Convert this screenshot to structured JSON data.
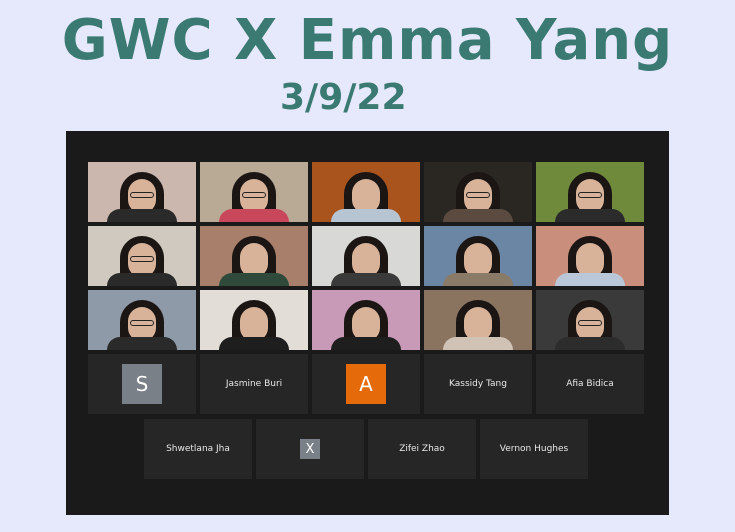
{
  "header": {
    "title": "GWC X Emma Yang",
    "date": "3/9/22"
  },
  "video_tiles": [
    {
      "bg": "#cbb7ad",
      "shirt": "#2a2a2a",
      "glasses": true
    },
    {
      "bg": "#b9aa96",
      "shirt": "#c9475a",
      "glasses": true
    },
    {
      "bg": "#a9541d",
      "shirt": "#b7c4d2",
      "glasses": false,
      "active": true
    },
    {
      "bg": "#2a2622",
      "shirt": "#5a4a40",
      "glasses": true
    },
    {
      "bg": "#6f8a3a",
      "shirt": "#2b2b2b",
      "glasses": true
    },
    {
      "bg": "#cfc9bf",
      "shirt": "#2a2a2a",
      "glasses": true
    },
    {
      "bg": "#a87f6a",
      "shirt": "#2f4a3a",
      "glasses": false
    },
    {
      "bg": "#d8d8d6",
      "shirt": "#3a3a3a",
      "glasses": false
    },
    {
      "bg": "#6b86a4",
      "shirt": "#8a7a68",
      "glasses": false
    },
    {
      "bg": "#c98e7c",
      "shirt": "#b9c7d8",
      "glasses": false
    },
    {
      "bg": "#8e9aa8",
      "shirt": "#2a2a2a",
      "glasses": true
    },
    {
      "bg": "#e2ddd6",
      "shirt": "#1e1e1e",
      "glasses": false
    },
    {
      "bg": "#c99ab8",
      "shirt": "#1e1e1e",
      "glasses": false
    },
    {
      "bg": "#8a7460",
      "shirt": "#d1c2b6",
      "glasses": false
    },
    {
      "bg": "#3a3a3a",
      "shirt": "#2c2c2c",
      "glasses": true
    }
  ],
  "avatar_tiles": [
    {
      "type": "avatar",
      "letter": "S",
      "color": "#7a8088"
    },
    {
      "type": "name",
      "name": "Jasmine Buri"
    },
    {
      "type": "avatar",
      "letter": "A",
      "color": "#e46a0a"
    },
    {
      "type": "name",
      "name": "Kassidy Tang"
    },
    {
      "type": "name",
      "name": "Afia Bidica"
    },
    {
      "type": "name",
      "name": "Shwetlana Jha"
    },
    {
      "type": "avatar-small",
      "letter": "X",
      "color": "#7a8088"
    },
    {
      "type": "name",
      "name": "Zifei Zhao"
    },
    {
      "type": "name",
      "name": "Vernon Hughes"
    }
  ]
}
